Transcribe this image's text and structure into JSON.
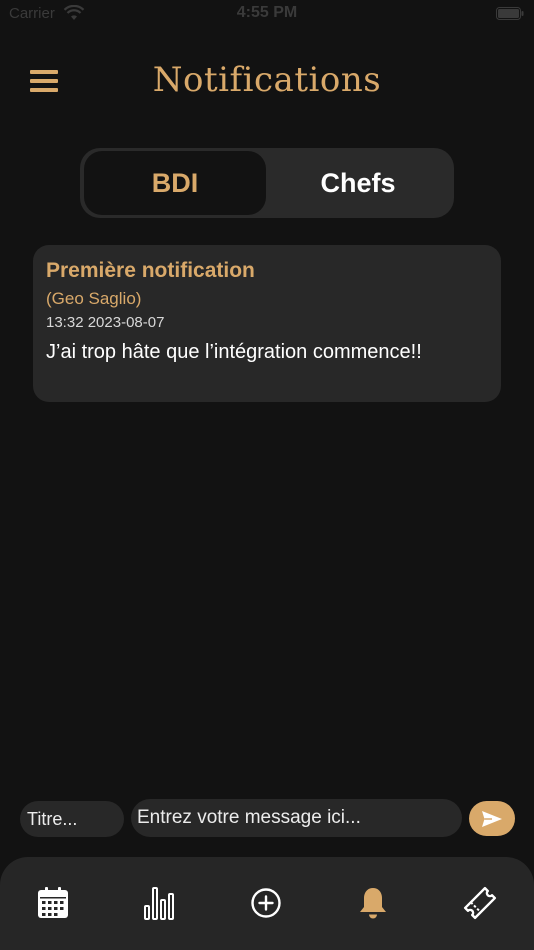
{
  "status_bar": {
    "carrier": "Carrier",
    "time": "4:55 PM",
    "wifi_icon": "wifi-icon",
    "battery_icon": "battery-icon"
  },
  "header": {
    "title": "Notifications",
    "menu_icon": "hamburger-menu-icon"
  },
  "segments": {
    "active": "BDI",
    "inactive": "Chefs"
  },
  "notifications": [
    {
      "title": "Première notification",
      "author": "(Geo Saglio)",
      "datetime": "13:32 2023-08-07",
      "message": "J’ai trop hâte que l’intégration commence!!"
    }
  ],
  "composer": {
    "title_placeholder": "Titre...",
    "message_placeholder": "Entrez votre message ici...",
    "send_icon": "send-icon"
  },
  "tab_bar": {
    "tabs": [
      {
        "icon": "calendar-icon",
        "active": false
      },
      {
        "icon": "bar-chart-icon",
        "active": false
      },
      {
        "icon": "plus-circle-icon",
        "active": false
      },
      {
        "icon": "bell-icon",
        "active": true
      },
      {
        "icon": "ticket-icon",
        "active": false
      }
    ]
  },
  "colors": {
    "accent": "#d9a96a",
    "background": "#121212",
    "surface": "#282828",
    "text": "#ffffff"
  }
}
